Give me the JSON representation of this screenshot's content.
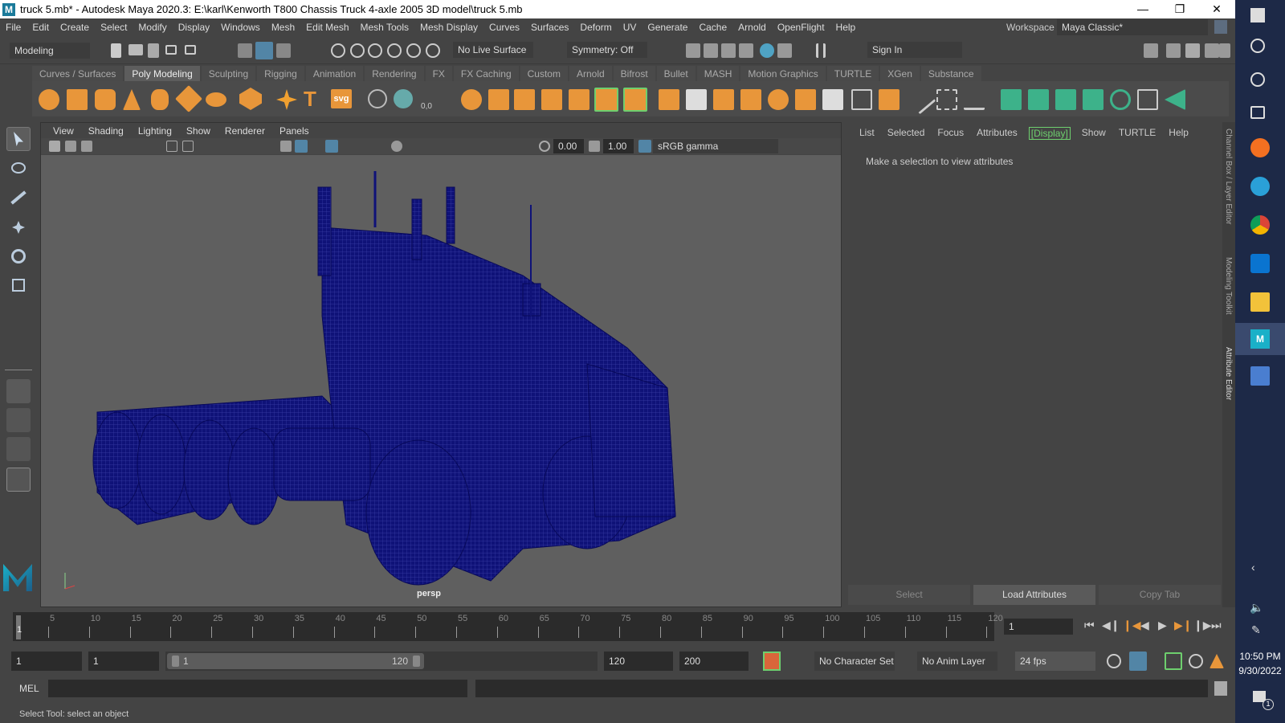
{
  "title": "truck 5.mb* - Autodesk Maya 2020.3: E:\\karl\\Kenworth T800 Chassis Truck 4-axle 2005 3D model\\truck 5.mb",
  "menus": [
    "File",
    "Edit",
    "Create",
    "Select",
    "Modify",
    "Display",
    "Windows",
    "Mesh",
    "Edit Mesh",
    "Mesh Tools",
    "Mesh Display",
    "Curves",
    "Surfaces",
    "Deform",
    "UV",
    "Generate",
    "Cache",
    "Arnold",
    "OpenFlight",
    "Help"
  ],
  "workspace": {
    "label": "Workspace :",
    "value": "Maya Classic*"
  },
  "status": {
    "mode": "Modeling",
    "live_surface": "No Live Surface",
    "symmetry": "Symmetry: Off",
    "sign_in": "Sign In"
  },
  "shelf_tabs": [
    "Curves / Surfaces",
    "Poly Modeling",
    "Sculpting",
    "Rigging",
    "Animation",
    "Rendering",
    "FX",
    "FX Caching",
    "Custom",
    "Arnold",
    "Bifrost",
    "Bullet",
    "MASH",
    "Motion Graphics",
    "TURTLE",
    "XGen",
    "Substance"
  ],
  "shelf_svg_label": "svg",
  "shelf_coord_label": "0,0",
  "panel_menu": [
    "View",
    "Shading",
    "Lighting",
    "Show",
    "Renderer",
    "Panels"
  ],
  "panel_fields": {
    "exposure": "0.00",
    "gamma": "1.00",
    "colorspace": "sRGB gamma"
  },
  "camera_label": "persp",
  "attr": {
    "tabs": [
      "List",
      "Selected",
      "Focus",
      "Attributes",
      "[Display]",
      "Show",
      "TURTLE",
      "Help"
    ],
    "message": "Make a selection to view attributes",
    "buttons": [
      "Select",
      "Load Attributes",
      "Copy Tab"
    ]
  },
  "side_tabs": [
    "Channel Box / Layer Editor",
    "Modeling Toolkit",
    "Attribute Editor"
  ],
  "timeline": {
    "ticks": [
      "5",
      "10",
      "15",
      "20",
      "25",
      "30",
      "35",
      "40",
      "45",
      "50",
      "55",
      "60",
      "65",
      "70",
      "75",
      "80",
      "85",
      "90",
      "95",
      "100",
      "105",
      "110",
      "115",
      "120"
    ],
    "current": "1",
    "current_field": "1"
  },
  "range": {
    "start": "1",
    "anim_start": "1",
    "slider_start": "1",
    "slider_end": "120",
    "end": "120",
    "anim_end": "200",
    "character_set": "No Character Set",
    "anim_layer": "No Anim Layer",
    "fps": "24 fps"
  },
  "mel": {
    "label": "MEL"
  },
  "help_line": "Select Tool: select an object",
  "clock": {
    "time": "10:50 PM",
    "date": "9/30/2022",
    "notifications": "1"
  },
  "colors": {
    "accent": "#5285a6",
    "mesh": "#10127a",
    "highlight_green": "#6ecf6e"
  }
}
